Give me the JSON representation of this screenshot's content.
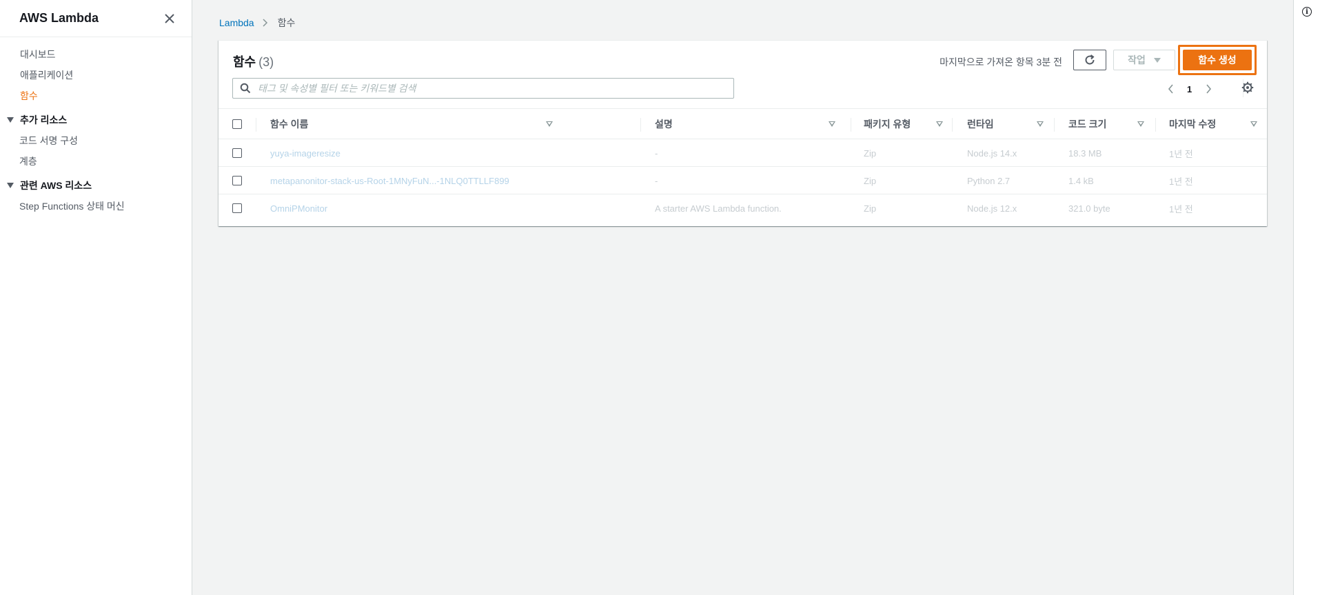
{
  "sidebar": {
    "title": "AWS Lambda",
    "items": [
      {
        "label": "대시보드"
      },
      {
        "label": "애플리케이션"
      },
      {
        "label": "함수"
      }
    ],
    "sections": [
      {
        "label": "추가 리소스",
        "items": [
          {
            "label": "코드 서명 구성"
          },
          {
            "label": "계층"
          }
        ]
      },
      {
        "label": "관련 AWS 리소스",
        "items": [
          {
            "label": "Step Functions 상태 머신"
          }
        ]
      }
    ]
  },
  "breadcrumb": {
    "parent": "Lambda",
    "current": "함수"
  },
  "panel": {
    "title": "함수",
    "count": "(3)",
    "last_fetched": "마지막으로 가져온 항목 3분 전",
    "actions_label": "작업",
    "create_label": "함수 생성",
    "search_placeholder": "태그 및 속성별 필터 또는 키워드별 검색",
    "page": "1"
  },
  "table": {
    "headers": {
      "name": "함수 이름",
      "description": "설명",
      "package": "패키지 유형",
      "runtime": "런타임",
      "code_size": "코드 크기",
      "modified": "마지막 수정"
    },
    "rows": [
      {
        "name": "yuya-imageresize",
        "description": "-",
        "package": "Zip",
        "runtime": "Node.js 14.x",
        "code_size": "18.3 MB",
        "modified": "1년 전"
      },
      {
        "name": "metapanonitor-stack-us-Root-1MNyFuN...-1NLQ0TTLLF899",
        "description": "-",
        "package": "Zip",
        "runtime": "Python 2.7",
        "code_size": "1.4 kB",
        "modified": "1년 전"
      },
      {
        "name": "OmniPMonitor",
        "description": "A starter AWS Lambda function.",
        "package": "Zip",
        "runtime": "Node.js 12.x",
        "code_size": "321.0 byte",
        "modified": "1년 전"
      }
    ]
  },
  "colors": {
    "accent": "#ec7211",
    "link": "#0073bb"
  }
}
